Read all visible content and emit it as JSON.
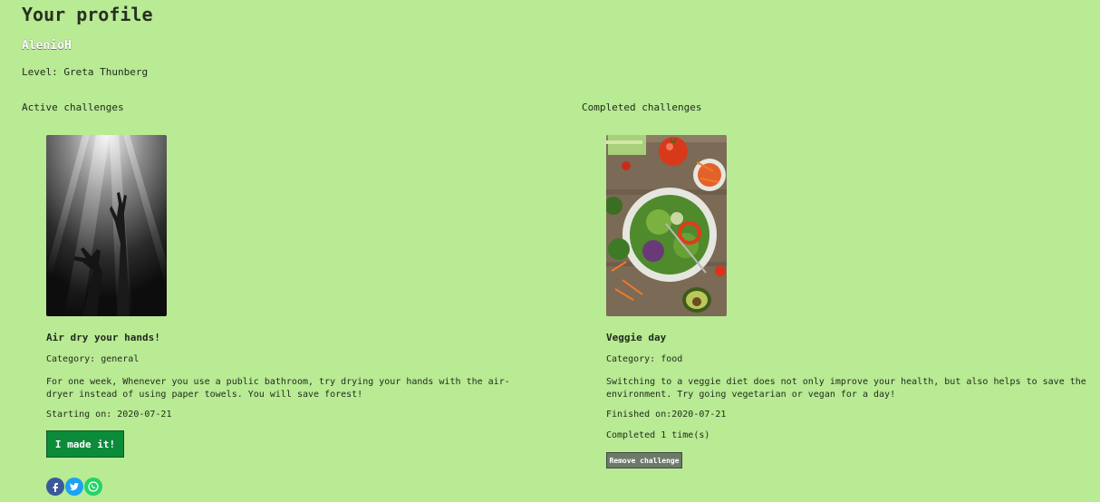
{
  "header": {
    "title": "Your profile",
    "username": "AlenioH",
    "level_text": "Level: Greta Thunberg"
  },
  "active": {
    "heading": "Active challenges",
    "challenge": {
      "title": "Air dry your hands!",
      "category": "Category: general",
      "description": "For one week, Whenever you use a public bathroom, try drying your hands with the air-dryer instead of using paper towels. You will save forest!",
      "date": "Starting on: 2020-07-21",
      "button_label": "I made it!"
    },
    "share": {
      "icons": [
        "facebook-icon",
        "twitter-icon",
        "whatsapp-icon"
      ],
      "colors": {
        "facebook": "#3b5998",
        "twitter": "#1da1f2",
        "whatsapp": "#25d366"
      }
    }
  },
  "completed": {
    "heading": "Completed challenges",
    "challenge": {
      "title": "Veggie day",
      "category": "Category: food",
      "description": "Switching to a veggie diet does not only improve your health, but also helps to save the environment. Try going vegetarian or vegan for a day!",
      "date": "Finished on:2020-07-21",
      "count": "Completed 1 time(s)",
      "button_label": "Remove challenge"
    }
  },
  "colors": {
    "background": "#b9ea94",
    "primary_button": "#0c8b3a",
    "secondary_button": "#6d7a6a"
  }
}
